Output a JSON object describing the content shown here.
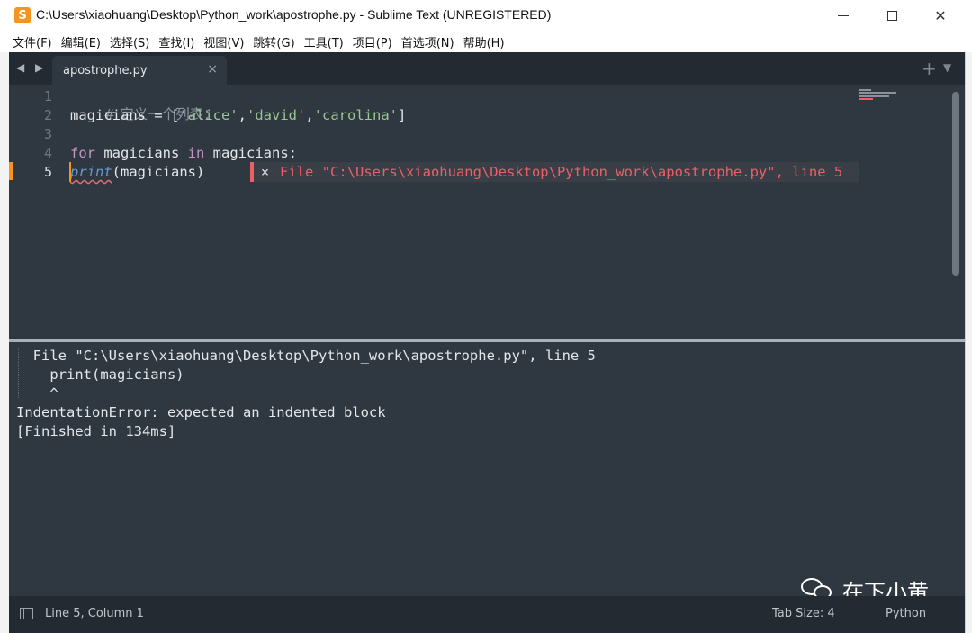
{
  "window": {
    "title": "C:\\Users\\xiaohuang\\Desktop\\Python_work\\apostrophe.py - Sublime Text (UNREGISTERED)",
    "app_icon": "S",
    "close_glyph": "✕"
  },
  "menu": [
    "文件(F)",
    "编辑(E)",
    "选择(S)",
    "查找(I)",
    "视图(V)",
    "跳转(G)",
    "工具(T)",
    "项目(P)",
    "首选项(N)",
    "帮助(H)"
  ],
  "tabs": {
    "nav_arrows": "◀ ▶",
    "active_tab": "apostrophe.py",
    "close_glyph": "×",
    "new_tab_glyph": "+",
    "menu_glyph": "▼"
  },
  "editor": {
    "line_numbers": [
      "1",
      "2",
      "3",
      "4",
      "5"
    ],
    "active_line": "5",
    "line1_comment": "# 定义一个列表：",
    "line2": {
      "var": "magicians",
      "assign": " = [",
      "s1": "'alice'",
      "comma1": ",",
      "s2": "'david'",
      "comma2": ",",
      "s3": "'carolina'",
      "close": "]"
    },
    "line4": {
      "kw_for": "for",
      "mid1": " magicians ",
      "kw_in": "in",
      "mid2": " magicians:"
    },
    "line5": {
      "fn": "print",
      "args": "(magicians)"
    },
    "inline_error": {
      "close_glyph": "×",
      "message": "File \"C:\\Users\\xiaohuang\\Desktop\\Python_work\\apostrophe.py\", line 5"
    }
  },
  "console": {
    "lines": [
      "  File \"C:\\Users\\xiaohuang\\Desktop\\Python_work\\apostrophe.py\", line 5",
      "    print(magicians)",
      "    ^",
      "IndentationError: expected an indented block",
      "[Finished in 134ms]"
    ]
  },
  "watermark": {
    "text": "在下小黄"
  },
  "statusbar": {
    "position": "Line 5, Column 1",
    "tab_size": "Tab Size: 4",
    "syntax": "Python"
  },
  "colors": {
    "editor_bg": "#2f3740",
    "accent": "#f7931e",
    "error": "#ec5f67",
    "string": "#99c794",
    "keyword": "#c594c5",
    "builtin": "#6699cc"
  }
}
